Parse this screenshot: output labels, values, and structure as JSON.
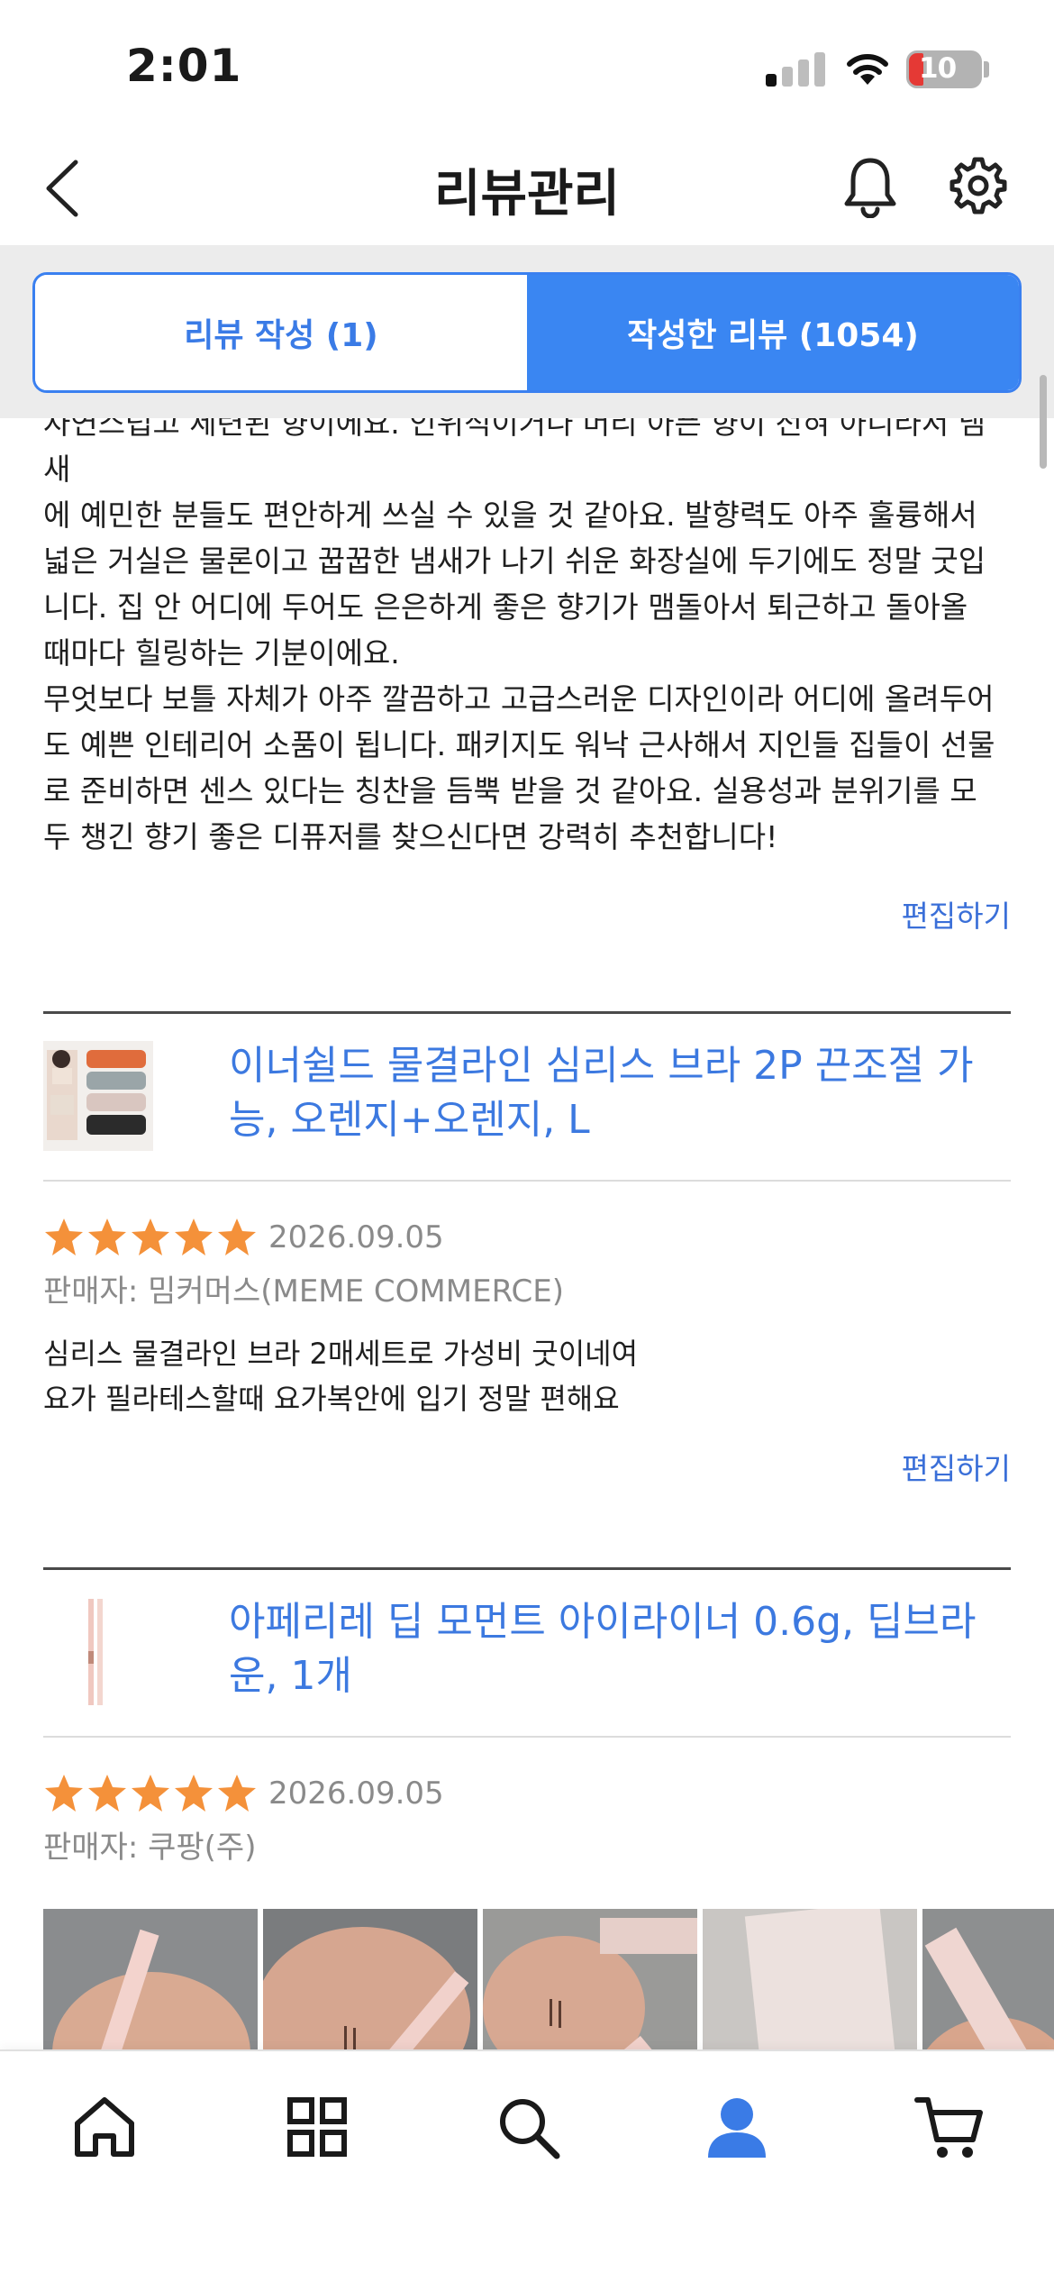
{
  "status_bar": {
    "time": "2:01",
    "battery": "10"
  },
  "nav": {
    "title": "리뷰관리"
  },
  "tabs": {
    "write": "리뷰 작성 (1)",
    "written": "작성한 리뷰 (1054)",
    "active": "written"
  },
  "reviews": [
    {
      "text_lines": [
        "자연스럽고 세련된 향이에요. 인위적이거나 머리 아픈 향이 전혀 아니라서 냄새",
        "에 예민한 분들도 편안하게 쓰실 수 있을 것 같아요. 발향력도 아주 훌륭해서",
        "넓은 거실은 물론이고 꿉꿉한 냄새가 나기 쉬운 화장실에 두기에도 정말 굿입",
        "니다. 집 안 어디에 두어도 은은하게 좋은 향기가 맴돌아서 퇴근하고 돌아올",
        "때마다 힐링하는 기분이에요.",
        "무엇보다 보틀 자체가 아주 깔끔하고 고급스러운 디자인이라 어디에 올려두어",
        "도 예쁜 인테리어 소품이 됩니다. 패키지도 워낙 근사해서 지인들 집들이 선물",
        "로 준비하면 센스 있다는 칭찬을 듬뿍 받을 것 같아요. 실용성과 분위기를 모",
        "두 챙긴 향기 좋은 디퓨저를 찾으신다면 강력히 추천합니다!"
      ],
      "edit_label": "편집하기"
    },
    {
      "product_name": "이너쉴드 물결라인 심리스 브라 2P 끈조절 가능, 오렌지+오렌지, L",
      "rating": 5,
      "date": "2026.09.05",
      "seller": "판매자: 밈커머스(MEME COMMERCE)",
      "text_lines": [
        "심리스 물결라인 브라 2매세트로 가성비 굿이네여",
        "요가 필라테스할때 요가복안에 입기 정말 편해요"
      ],
      "edit_label": "편집하기"
    },
    {
      "product_name": "아페리레 딥 모먼트 아이라이너 0.6g, 딥브라운, 1개",
      "rating": 5,
      "date": "2026.09.05",
      "seller": "판매자: 쿠팡(주)"
    }
  ],
  "bottom_tabs": [
    {
      "icon": "home-icon"
    },
    {
      "icon": "category-grid-icon"
    },
    {
      "icon": "search-icon"
    },
    {
      "icon": "my-profile-icon",
      "active": true
    },
    {
      "icon": "cart-icon"
    }
  ],
  "colors": {
    "accent": "#3a86f2",
    "link": "#3a6fd8",
    "star": "#f4913a"
  }
}
